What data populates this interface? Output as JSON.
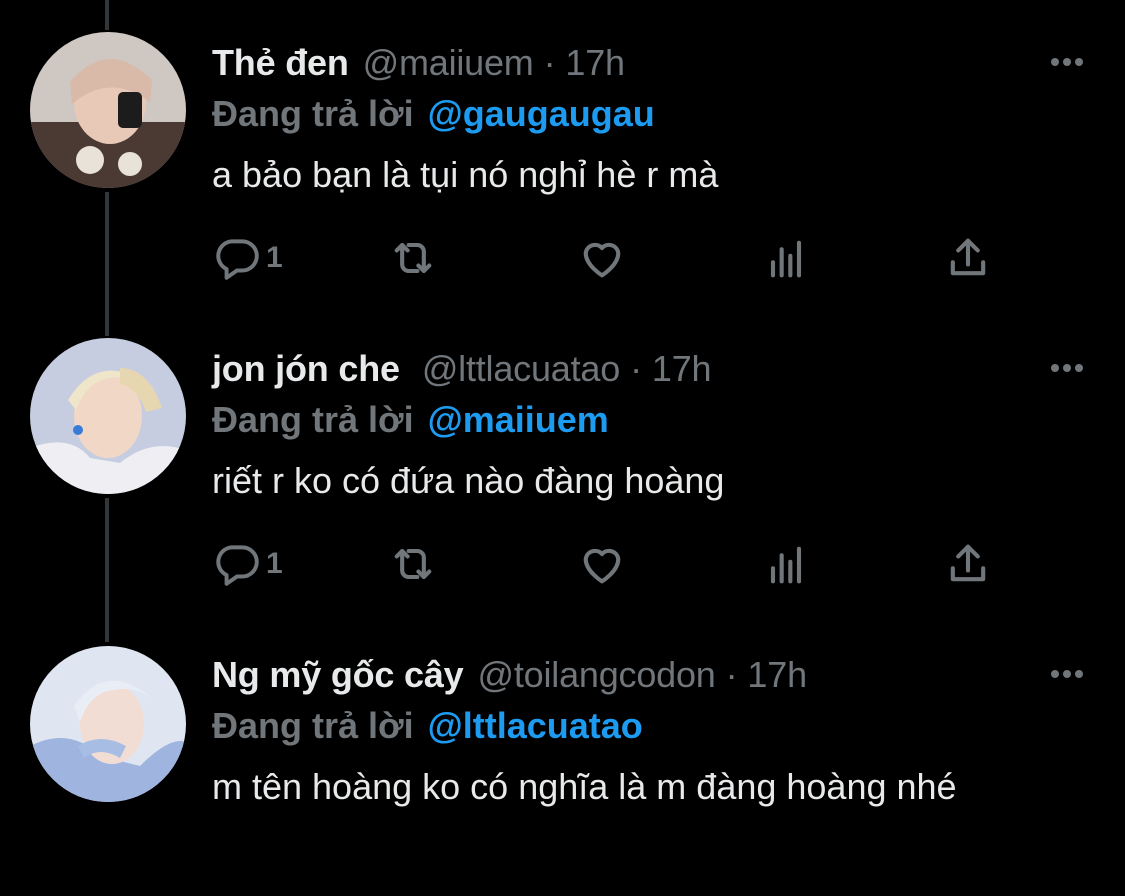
{
  "colors": {
    "background": "#000000",
    "text": "#e7e9ea",
    "muted": "#71767b",
    "link": "#1d9bf0"
  },
  "tweets": [
    {
      "name": "Thẻ đen",
      "handle": "@maiiuem",
      "separator": "·",
      "time": "17h",
      "replying_label": "Đang trả lời",
      "replying_to": "@gaugaugau",
      "text": "a bảo bạn là tụi nó nghỉ hè r mà",
      "reply_count": "1"
    },
    {
      "name": "jon jón che",
      "handle": "@lttlacuatao",
      "separator": "·",
      "time": "17h",
      "replying_label": "Đang trả lời",
      "replying_to": "@maiiuem",
      "text": "riết r ko có đứa nào đàng hoàng",
      "reply_count": "1"
    },
    {
      "name": "Ng mỹ gốc cây",
      "handle": "@toilangcodon",
      "separator": "·",
      "time": "17h",
      "replying_label": "Đang trả lời",
      "replying_to": "@lttlacuatao",
      "text": "m tên hoàng ko có nghĩa là m đàng hoàng nhé",
      "reply_count": ""
    }
  ],
  "icons": {
    "more": "more-horizontal-icon",
    "reply": "reply-bubble-icon",
    "retweet": "retweet-icon",
    "like": "heart-icon",
    "views": "views-bar-chart-icon",
    "share": "share-upload-icon"
  }
}
